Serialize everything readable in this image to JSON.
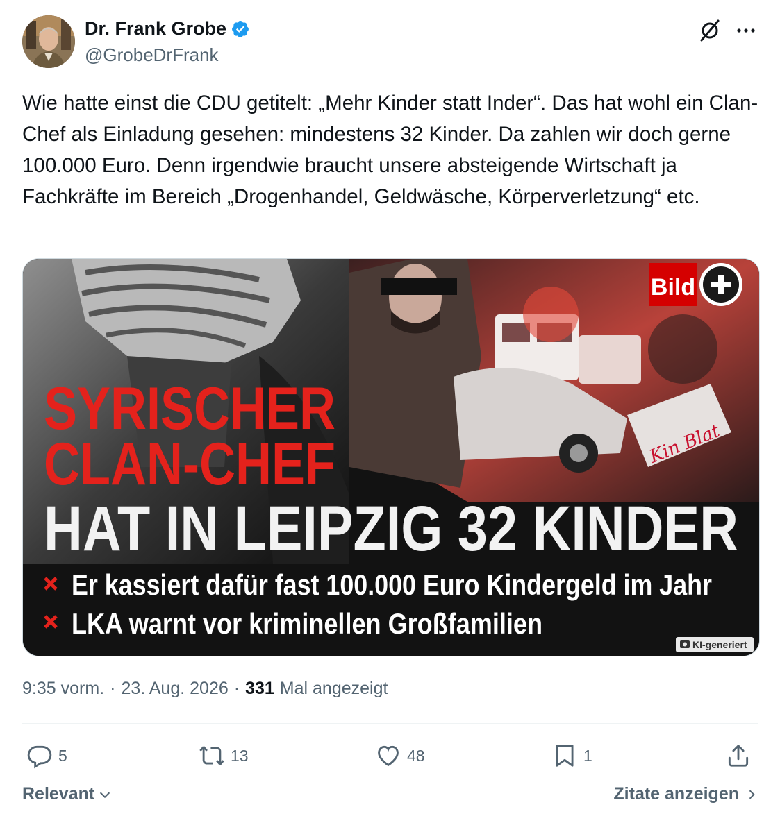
{
  "author": {
    "display_name": "Dr. Frank Grobe",
    "handle": "@GrobeDrFrank",
    "verified": true,
    "verified_color": "#1d9bf0"
  },
  "tweet": {
    "text": "Wie hatte einst die CDU getitelt: „Mehr Kinder statt Inder“. Das hat wohl ein Clan-Chef als Einladung gesehen: mindestens 32 Kinder. Da zahlen wir doch gerne 100.000 Euro. Denn irgendwie braucht unsere absteigende Wirtschaft ja Fachkräfte im Bereich „Drogenhandel, Geldwäsche, Körperverletzung“ etc."
  },
  "media": {
    "brand": "Bild",
    "headline_red_1": "SYRISCHER",
    "headline_red_2": "CLAN-CHEF",
    "headline_white": "HAT IN LEIPZIG 32 KINDER",
    "bullet_1": "Er kassiert dafür fast 100.000 Euro Kindergeld im Jahr",
    "bullet_2": "LKA warnt vor kriminellen Großfamilien",
    "ai_label": "KI-generiert",
    "graffiti": "Kin Blat"
  },
  "meta": {
    "time": "9:35 vorm.",
    "sep1": "·",
    "date": "23. Aug. 2026",
    "sep2": "·",
    "views": "331",
    "views_label": "Mal angezeigt"
  },
  "actions": {
    "replies": "5",
    "reposts": "13",
    "likes": "48",
    "bookmarks": "1"
  },
  "footer": {
    "sort_label": "Relevant",
    "quotes_label": "Zitate anzeigen"
  },
  "colors": {
    "text": "#0f1419",
    "muted": "#536471",
    "bild_red": "#d50000",
    "headline_red": "#e4221c"
  },
  "icons": [
    "verified-badge-icon",
    "grok-icon",
    "more-icon",
    "reply-icon",
    "repost-icon",
    "like-icon",
    "bookmark-icon",
    "share-icon",
    "chevron-down-icon",
    "chevron-right-icon",
    "camera-icon",
    "cross-bullet-icon"
  ]
}
